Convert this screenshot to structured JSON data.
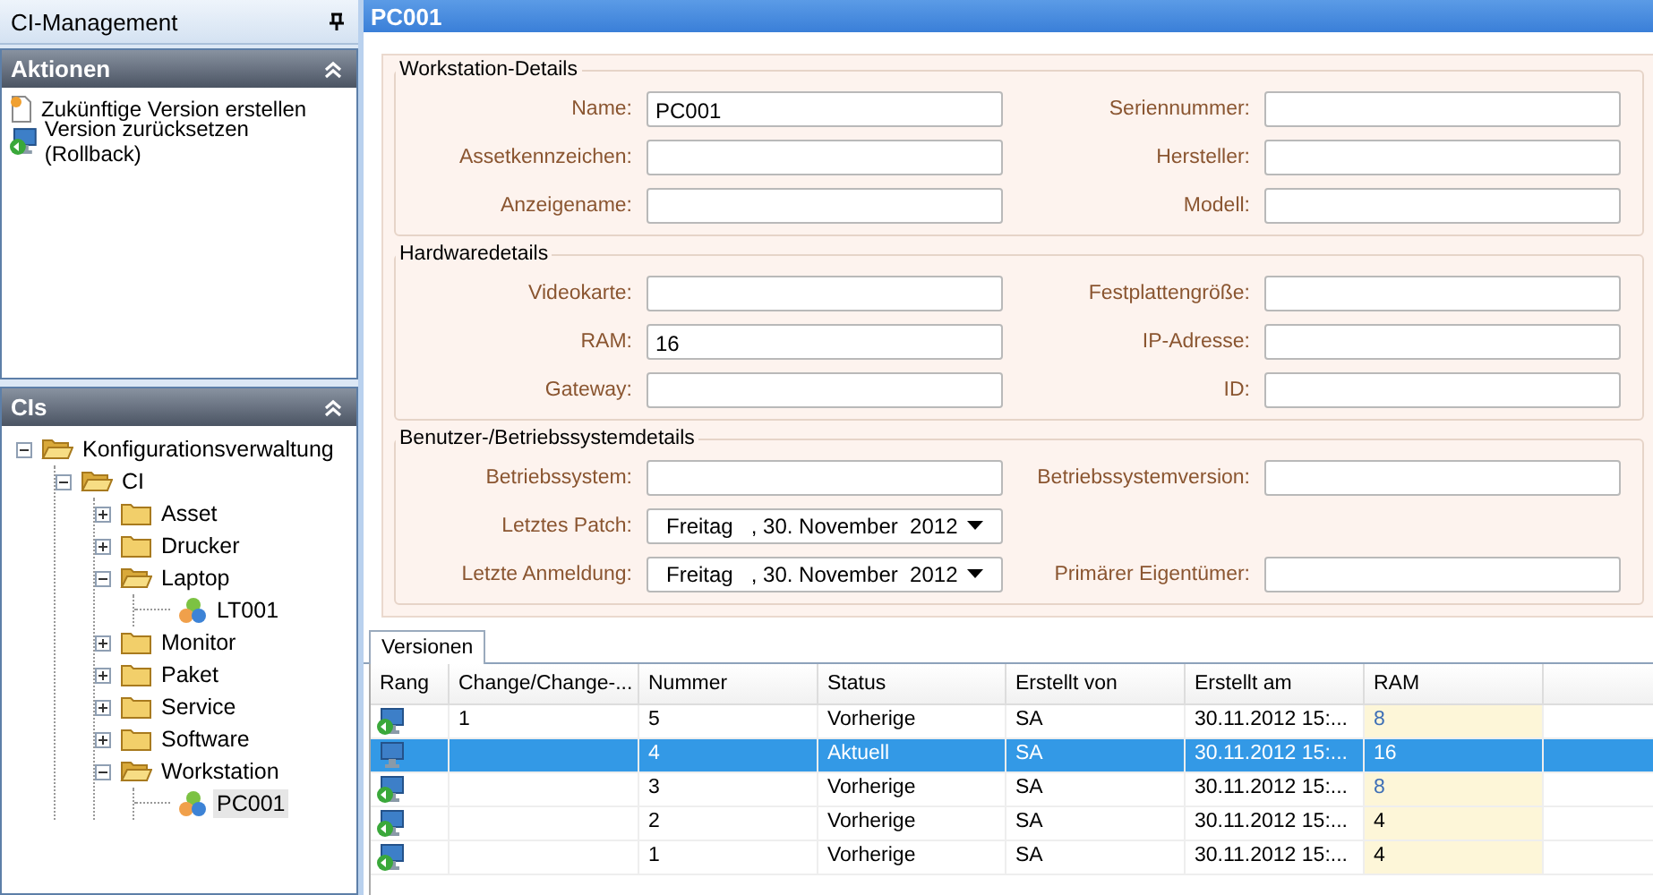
{
  "sidebar": {
    "title": "CI-Management",
    "actions": {
      "title": "Aktionen",
      "expanded": true,
      "items": [
        {
          "label": "Zukünftige Version erstellen",
          "kind": "new"
        },
        {
          "label": "Version zurücksetzen (Rollback)",
          "kind": "rollback"
        }
      ]
    },
    "tree_panel": {
      "title": "CIs",
      "expanded": true
    },
    "tree": [
      {
        "label": "Konfigurationsverwaltung",
        "kind": "folder",
        "expanded": true,
        "selected": false,
        "children": [
          {
            "label": "CI",
            "kind": "folder",
            "expanded": true,
            "selected": false,
            "children": [
              {
                "label": "Asset",
                "kind": "folder",
                "expanded": false,
                "selected": false
              },
              {
                "label": "Drucker",
                "kind": "folder",
                "expanded": false,
                "selected": false
              },
              {
                "label": "Laptop",
                "kind": "folder",
                "expanded": true,
                "selected": false,
                "children": [
                  {
                    "label": "LT001",
                    "kind": "item",
                    "selected": false
                  }
                ]
              },
              {
                "label": "Monitor",
                "kind": "folder",
                "expanded": false,
                "selected": false
              },
              {
                "label": "Paket",
                "kind": "folder",
                "expanded": false,
                "selected": false
              },
              {
                "label": "Service",
                "kind": "folder",
                "expanded": false,
                "selected": false
              },
              {
                "label": "Software",
                "kind": "folder",
                "expanded": false,
                "selected": false
              },
              {
                "label": "Workstation",
                "kind": "folder",
                "expanded": true,
                "selected": false,
                "children": [
                  {
                    "label": "PC001",
                    "kind": "item",
                    "selected": true
                  }
                ]
              }
            ]
          }
        ]
      }
    ]
  },
  "window": {
    "title": "PC001"
  },
  "groups": [
    {
      "title": "Workstation-Details",
      "rows": [
        [
          {
            "label": "Name:",
            "kind": "text",
            "value": "PC001"
          },
          {
            "label": "Seriennummer:",
            "kind": "text"
          }
        ],
        [
          {
            "label": "Assetkennzeichen:",
            "kind": "text"
          },
          {
            "label": "Hersteller:",
            "kind": "text"
          }
        ],
        [
          {
            "label": "Anzeigename:",
            "kind": "text"
          },
          {
            "label": "Modell:",
            "kind": "text"
          }
        ]
      ]
    },
    {
      "title": "Hardwaredetails",
      "rows": [
        [
          {
            "label": "Videokarte:",
            "kind": "text"
          },
          {
            "label": "Festplattengröße:",
            "kind": "text"
          }
        ],
        [
          {
            "label": "RAM:",
            "kind": "text",
            "value": "16"
          },
          {
            "label": "IP-Adresse:",
            "kind": "text"
          }
        ],
        [
          {
            "label": "Gateway:",
            "kind": "text"
          },
          {
            "label": "ID:",
            "kind": "text"
          }
        ]
      ]
    },
    {
      "title": "Benutzer-/Betriebssystemdetails",
      "rows": [
        [
          {
            "label": "Betriebssystem:",
            "kind": "text"
          },
          {
            "label": "Betriebssystemversion:",
            "kind": "text"
          }
        ],
        [
          {
            "label": "Letztes Patch:",
            "kind": "date",
            "value": "Freitag   , 30. November  2012"
          }
        ],
        [
          {
            "label": "Letzte Anmeldung:",
            "kind": "date",
            "value": "Freitag   , 30. November  2012"
          },
          {
            "label": "Primärer Eigentümer:",
            "kind": "text"
          }
        ]
      ]
    }
  ],
  "bottom_tabs": [
    {
      "label": "Versionen",
      "selected": true
    }
  ],
  "table": {
    "columns": [
      "Rang",
      "Change/Change-...",
      "Nummer",
      "Status",
      "Erstellt von",
      "Erstellt am",
      "RAM"
    ],
    "rows": [
      {
        "kind": "rollback",
        "selected": false,
        "change": "1",
        "nummer": "5",
        "status": "Vorherige",
        "erstellt_von": "SA",
        "erstellt_am": "30.11.2012 15:...",
        "ram": "8",
        "ram_changed": true
      },
      {
        "kind": "current",
        "selected": true,
        "nummer": "4",
        "status": "Aktuell",
        "erstellt_von": "SA",
        "erstellt_am": "30.11.2012 15:...",
        "ram": "16",
        "ram_changed": true
      },
      {
        "kind": "rollback",
        "selected": false,
        "nummer": "3",
        "status": "Vorherige",
        "erstellt_von": "SA",
        "erstellt_am": "30.11.2012 15:...",
        "ram": "8",
        "ram_changed": true
      },
      {
        "kind": "rollback",
        "selected": false,
        "nummer": "2",
        "status": "Vorherige",
        "erstellt_von": "SA",
        "erstellt_am": "30.11.2012 15:...",
        "ram": "4",
        "ram_changed": false
      },
      {
        "kind": "rollback",
        "selected": false,
        "nummer": "1",
        "status": "Vorherige",
        "erstellt_von": "SA",
        "erstellt_am": "30.11.2012 15:...",
        "ram": "4",
        "ram_changed": false
      }
    ]
  }
}
